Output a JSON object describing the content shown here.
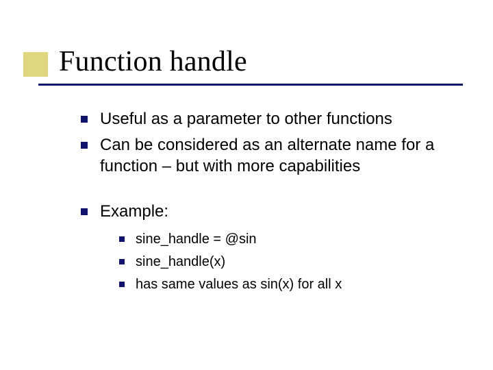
{
  "title": "Function handle",
  "bullets": {
    "b0": "Useful as a parameter to other functions",
    "b1": "Can be considered as an alternate name for a function – but with more capabilities",
    "b2": "Example:",
    "sub": {
      "s0": "sine_handle = @sin",
      "s1": "sine_handle(x)",
      "s2": "has same values as sin(x)  for all x"
    }
  }
}
